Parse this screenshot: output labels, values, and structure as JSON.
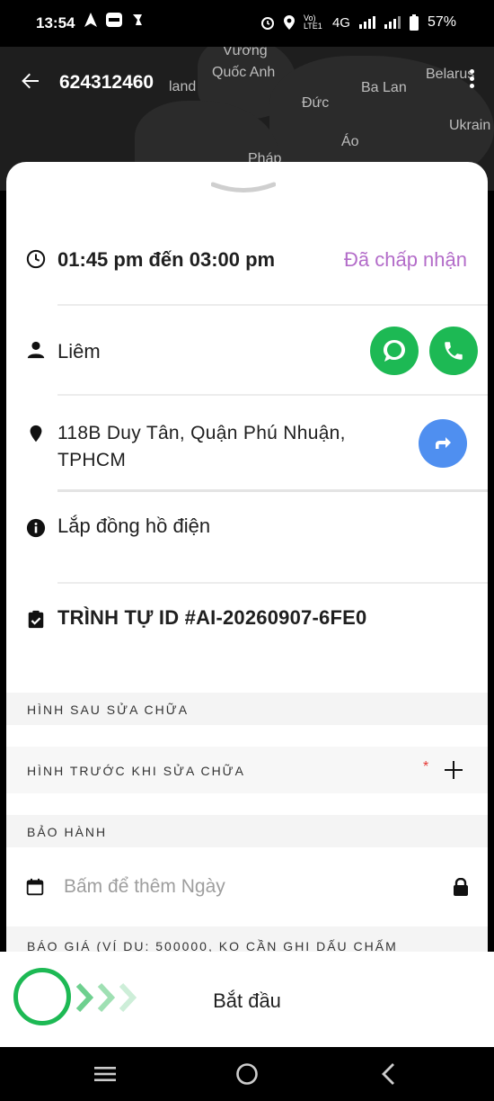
{
  "status_bar": {
    "time": "13:54",
    "carrier": "Vo) LTE1",
    "network": "4G",
    "battery": "57%"
  },
  "map": {
    "labels": [
      "Vương",
      "Quốc Anh",
      "land",
      "Ba Lan",
      "Belarus",
      "Đức",
      "Ukrain",
      "Áo",
      "Pháp"
    ]
  },
  "header": {
    "order_id": "624312460"
  },
  "appointment": {
    "time_range": "01:45 pm đến 03:00 pm",
    "status": "Đã chấp nhận"
  },
  "customer": {
    "name": "Liêm"
  },
  "address": {
    "text": "118B Duy Tân, Quận Phú Nhuận, TPHCM"
  },
  "service": {
    "name": "Lắp đồng hồ điện"
  },
  "sequence": {
    "label": "TRÌNH TỰ ID #AI-20260907-6FE0"
  },
  "sections": {
    "after_repair": "HÌNH SAU SỬA CHỮA",
    "before_repair": "HÌNH TRƯỚC KHI SỬA CHỮA",
    "required_mark": "*",
    "warranty": "BẢO HÀNH",
    "warranty_placeholder": "Bấm để thêm Ngày",
    "quote": "BÁO GIÁ (VÍ DỤ: 500000, KO CẦN GHI DẤU CHẤM"
  },
  "action": {
    "start_label": "Bắt đầu"
  },
  "colors": {
    "accent_green": "#1db954",
    "accent_purple": "#b36cc9",
    "accent_blue": "#4f8ff0"
  }
}
